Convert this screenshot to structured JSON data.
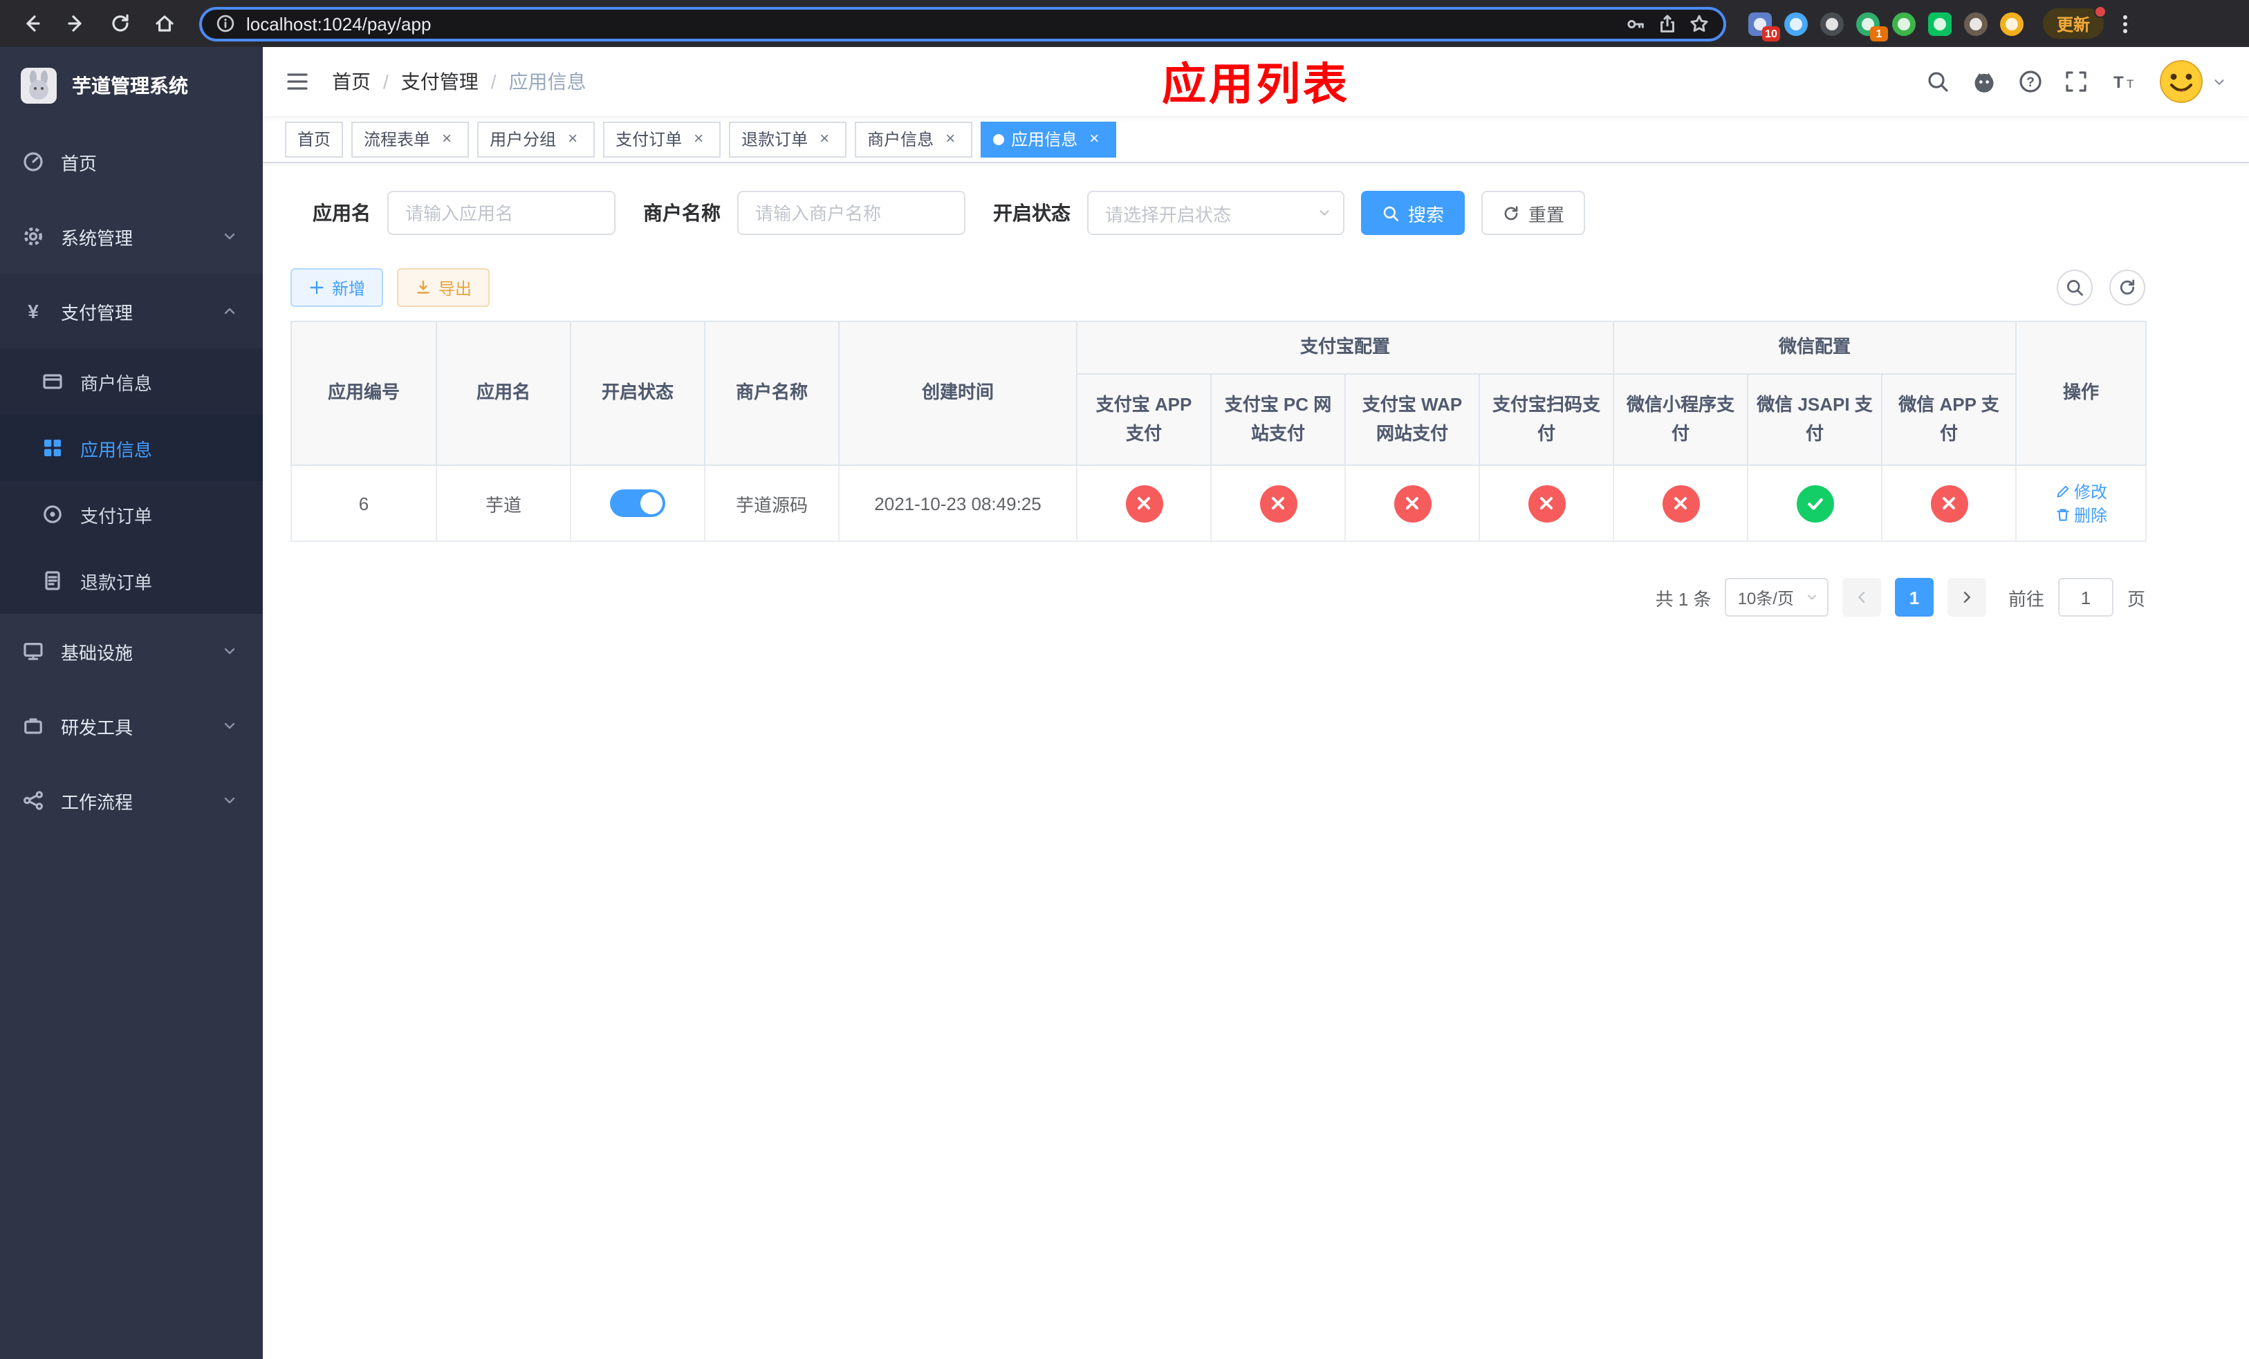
{
  "browser": {
    "url": "localhost:1024/pay/app",
    "update_label": "更新",
    "extension_badges": {
      "badge_10": "10",
      "badge_1": "1"
    }
  },
  "icons": {
    "close": "×",
    "yen": "¥",
    "separator": "/",
    "question": "?",
    "font_large": "T",
    "font_small": "T"
  },
  "sidebar": {
    "title": "芋道管理系统",
    "items": [
      {
        "label": "首页"
      },
      {
        "label": "系统管理"
      },
      {
        "label": "支付管理"
      },
      {
        "label": "基础设施"
      },
      {
        "label": "研发工具"
      },
      {
        "label": "工作流程"
      }
    ],
    "submenu": [
      {
        "label": "商户信息"
      },
      {
        "label": "应用信息"
      },
      {
        "label": "支付订单"
      },
      {
        "label": "退款订单"
      }
    ]
  },
  "header": {
    "breadcrumb": [
      "首页",
      "支付管理",
      "应用信息"
    ],
    "title": "应用列表"
  },
  "tabs": [
    {
      "label": "首页"
    },
    {
      "label": "流程表单"
    },
    {
      "label": "用户分组"
    },
    {
      "label": "支付订单"
    },
    {
      "label": "退款订单"
    },
    {
      "label": "商户信息"
    },
    {
      "label": "应用信息"
    }
  ],
  "filters": {
    "app_name_label": "应用名",
    "app_name_placeholder": "请输入应用名",
    "merchant_label": "商户名称",
    "merchant_placeholder": "请输入商户名称",
    "status_label": "开启状态",
    "status_placeholder": "请选择开启状态",
    "search_label": "搜索",
    "reset_label": "重置"
  },
  "toolbar": {
    "add_label": "新增",
    "export_label": "导出"
  },
  "table": {
    "base_columns": [
      "应用编号",
      "应用名",
      "开启状态",
      "商户名称",
      "创建时间"
    ],
    "groups": {
      "alipay": "支付宝配置",
      "wechat": "微信配置"
    },
    "alipay_columns": [
      "支付宝 APP 支付",
      "支付宝 PC 网站支付",
      "支付宝 WAP 网站支付",
      "支付宝扫码支付"
    ],
    "wechat_columns": [
      "微信小程序支付",
      "微信 JSAPI 支付",
      "微信 APP 支付"
    ],
    "action_column": "操作",
    "rows": [
      {
        "id": "6",
        "name": "芋道",
        "enabled": true,
        "merchant": "芋道源码",
        "created": "2021-10-23 08:49:25",
        "configs": [
          "no",
          "no",
          "no",
          "no",
          "no",
          "yes",
          "no"
        ],
        "edit_label": "修改",
        "delete_label": "删除"
      }
    ]
  },
  "pagination": {
    "total": "共 1 条",
    "page_size": "10条/页",
    "current_page": "1",
    "goto_label": "前往",
    "goto_value": "1",
    "page_unit": "页"
  }
}
